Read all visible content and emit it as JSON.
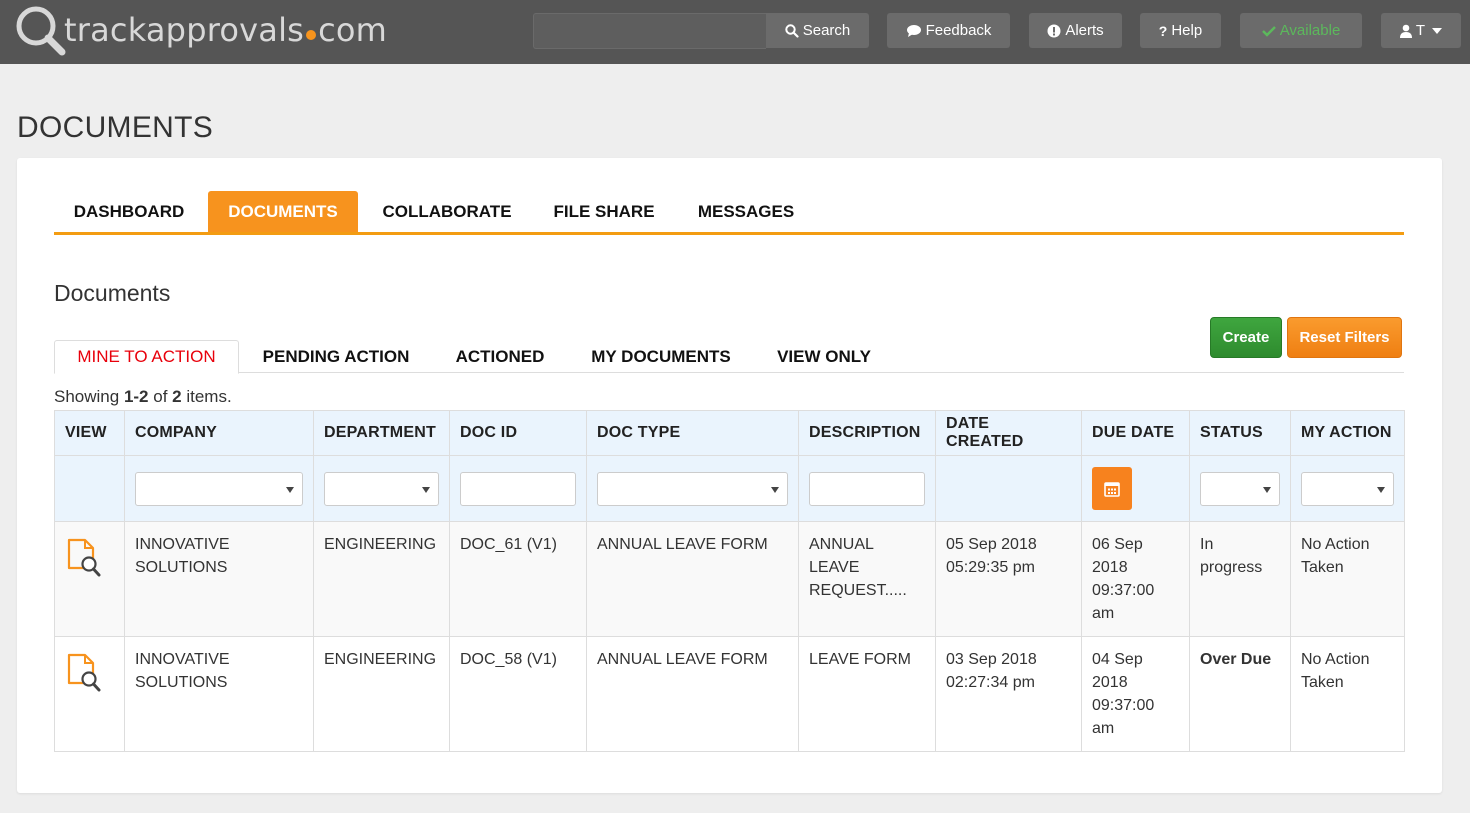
{
  "app": {
    "logo_text_left": "trackapprovals",
    "logo_text_right": "com",
    "accent_color": "#f7931e"
  },
  "topnav": {
    "search_placeholder": "",
    "search_label": "Search",
    "feedback_label": "Feedback",
    "alerts_label": "Alerts",
    "help_label": "Help",
    "available_label": "Available",
    "user_label": "T"
  },
  "page": {
    "title": "DOCUMENTS"
  },
  "main_tabs": [
    {
      "label": "DASHBOARD",
      "active": false
    },
    {
      "label": "DOCUMENTS",
      "active": true
    },
    {
      "label": "COLLABORATE",
      "active": false
    },
    {
      "label": "FILE SHARE",
      "active": false
    },
    {
      "label": "MESSAGES",
      "active": false
    }
  ],
  "section": {
    "title": "Documents",
    "create_label": "Create",
    "reset_label": "Reset Filters"
  },
  "sub_tabs": [
    {
      "label": "MINE TO ACTION",
      "active": true
    },
    {
      "label": "PENDING ACTION",
      "active": false
    },
    {
      "label": "ACTIONED",
      "active": false
    },
    {
      "label": "MY DOCUMENTS",
      "active": false
    },
    {
      "label": "VIEW ONLY",
      "active": false
    }
  ],
  "summary": {
    "prefix": "Showing ",
    "range": "1-2",
    "middle": " of ",
    "total": "2",
    "suffix": " items."
  },
  "table": {
    "columns": [
      "VIEW",
      "COMPANY",
      "DEPARTMENT",
      "DOC ID",
      "DOC TYPE",
      "DESCRIPTION",
      "DATE CREATED",
      "DUE DATE",
      "STATUS",
      "MY ACTION"
    ],
    "rows": [
      {
        "company": "INNOVATIVE SOLUTIONS",
        "department": "ENGINEERING",
        "doc_id": "DOC_61 (V1)",
        "doc_type": "ANNUAL LEAVE FORM",
        "description": "ANNUAL LEAVE REQUEST.....",
        "date_created": "05 Sep 2018 05:29:35 pm",
        "due_date": "06 Sep 2018 09:37:00 am",
        "status": "In progress",
        "my_action": "No Action Taken"
      },
      {
        "company": "INNOVATIVE SOLUTIONS",
        "department": "ENGINEERING",
        "doc_id": "DOC_58 (V1)",
        "doc_type": "ANNUAL LEAVE FORM",
        "description": "LEAVE FORM",
        "date_created": "03 Sep 2018 02:27:34 pm",
        "due_date": "04 Sep 2018 09:37:00 am",
        "status": "Over Due",
        "my_action": "No Action Taken"
      }
    ]
  }
}
